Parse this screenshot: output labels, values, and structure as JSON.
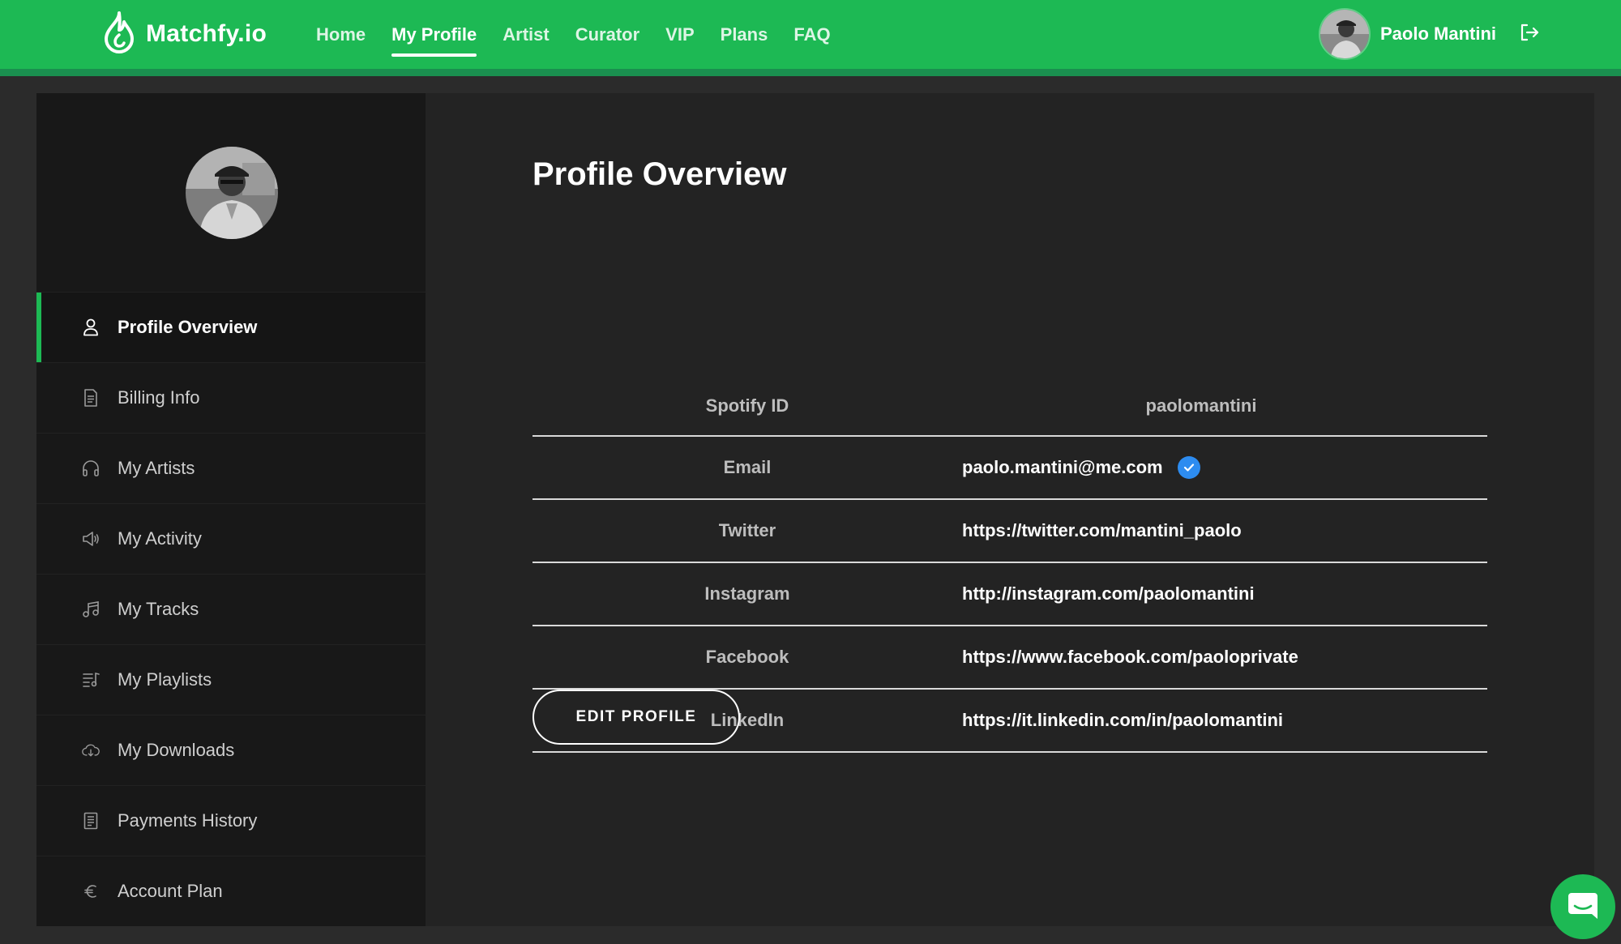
{
  "brand": {
    "name": "Matchfy.io",
    "icon": "flame-drop-logo",
    "color": "#1db954"
  },
  "nav": {
    "items": [
      {
        "label": "Home"
      },
      {
        "label": "My Profile",
        "active": true
      },
      {
        "label": "Artist"
      },
      {
        "label": "Curator"
      },
      {
        "label": "VIP"
      },
      {
        "label": "Plans"
      },
      {
        "label": "FAQ"
      }
    ]
  },
  "user": {
    "name": "Paolo Mantini",
    "logout_icon": "logout-icon"
  },
  "sidebar": {
    "items": [
      {
        "label": "Profile Overview",
        "icon": "user-icon",
        "active": true
      },
      {
        "label": "Billing Info",
        "icon": "document-icon"
      },
      {
        "label": "My Artists",
        "icon": "headphones-icon"
      },
      {
        "label": "My Activity",
        "icon": "megaphone-icon"
      },
      {
        "label": "My Tracks",
        "icon": "music-note-icon"
      },
      {
        "label": "My Playlists",
        "icon": "playlist-icon"
      },
      {
        "label": "My Downloads",
        "icon": "cloud-download-icon"
      },
      {
        "label": "Payments History",
        "icon": "receipt-icon"
      },
      {
        "label": "Account Plan",
        "icon": "euro-icon"
      }
    ]
  },
  "main": {
    "title": "Profile Overview",
    "rows": [
      {
        "label": "Spotify ID",
        "value": "paolomantini"
      },
      {
        "label": "Email",
        "value": "paolo.mantini@me.com",
        "verified": true
      },
      {
        "label": "Twitter",
        "value": "https://twitter.com/mantini_paolo"
      },
      {
        "label": "Instagram",
        "value": "http://instagram.com/paolomantini"
      },
      {
        "label": "Facebook",
        "value": "https://www.facebook.com/paoloprivate"
      },
      {
        "label": "LinkedIn",
        "value": "https://it.linkedin.com/in/paolomantini"
      }
    ],
    "edit_button": "EDIT PROFILE"
  },
  "chat": {
    "icon": "chat-icon"
  }
}
